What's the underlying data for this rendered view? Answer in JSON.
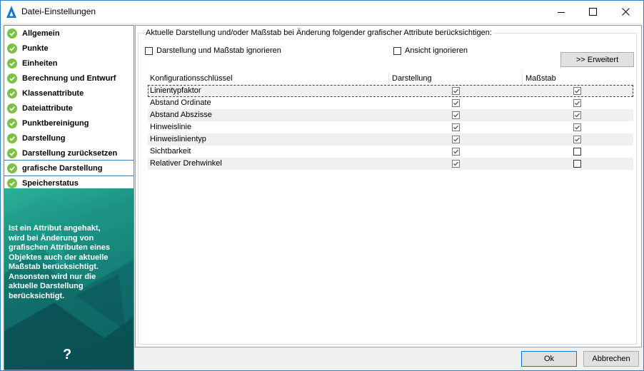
{
  "window": {
    "title": "Datei-Einstellungen"
  },
  "colors": {
    "accent": "#0078d7",
    "check": "#7cc242",
    "help_panel": "#16897d"
  },
  "sidebar": {
    "items": [
      {
        "label": "Allgemein",
        "icon": "green-check-icon"
      },
      {
        "label": "Punkte",
        "icon": "green-check-icon"
      },
      {
        "label": "Einheiten",
        "icon": "green-check-icon"
      },
      {
        "label": "Berechnung und Entwurf",
        "icon": "green-check-icon"
      },
      {
        "label": "Klassenattribute",
        "icon": "green-check-icon"
      },
      {
        "label": "Dateiattribute",
        "icon": "green-check-icon"
      },
      {
        "label": "Punktbereinigung",
        "icon": "green-check-icon"
      },
      {
        "label": "Darstellung",
        "icon": "green-check-icon"
      },
      {
        "label": "Darstellung zurücksetzen",
        "icon": "green-check-icon"
      },
      {
        "label": "grafische Darstellung",
        "icon": "green-check-icon",
        "selected": true
      },
      {
        "label": "Speicherstatus",
        "icon": "green-check-icon"
      }
    ],
    "help": {
      "lines": [
        "Ist ein Attribut angehakt,",
        "wird bei Änderung von",
        "grafischen Attributen eines",
        "Objektes auch der aktuelle",
        "Maßstab berücksichtigt.",
        "Ansonsten wird nur die",
        "aktuelle Darstellung",
        "berücksichtigt."
      ],
      "question": "?"
    }
  },
  "main": {
    "group_title": "Aktuelle Darstellung und/oder Maßstab bei Änderung folgender grafischer Attribute berücksichtigen:",
    "ignore_both_label": "Darstellung und Maßstab ignorieren",
    "ignore_both_checked": false,
    "ignore_view_label": "Ansicht ignorieren",
    "ignore_view_checked": false,
    "advanced_label": ">> Erweitert",
    "table": {
      "headers": [
        "Konfigurationsschlüssel",
        "Darstellung",
        "Maßstab"
      ],
      "rows": [
        {
          "key": "Linientypfaktor",
          "darstellung": true,
          "massstab": true,
          "selected": true
        },
        {
          "key": "Abstand Ordinate",
          "darstellung": true,
          "massstab": true
        },
        {
          "key": "Abstand Abszisse",
          "darstellung": true,
          "massstab": true
        },
        {
          "key": "Hinweislinie",
          "darstellung": true,
          "massstab": true
        },
        {
          "key": "Hinweislinientyp",
          "darstellung": true,
          "massstab": true
        },
        {
          "key": "Sichtbarkeit",
          "darstellung": true,
          "massstab": false
        },
        {
          "key": "Relativer Drehwinkel",
          "darstellung": true,
          "massstab": false
        }
      ]
    }
  },
  "footer": {
    "ok_label": "Ok",
    "cancel_label": "Abbrechen"
  }
}
